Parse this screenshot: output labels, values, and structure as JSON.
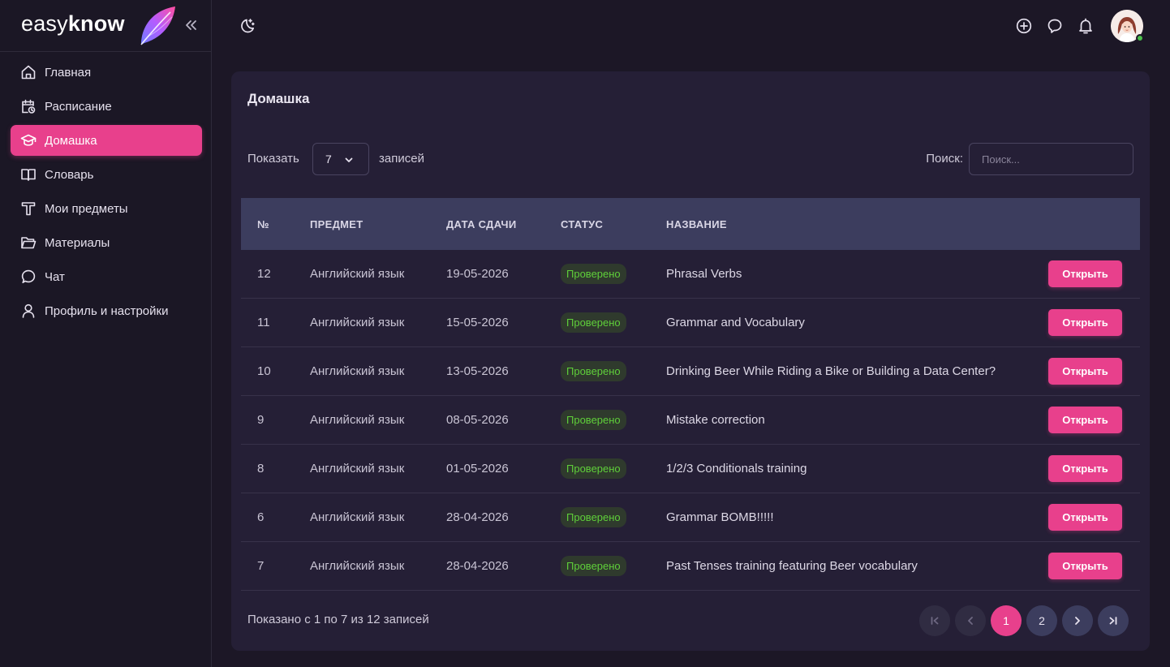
{
  "brand": {
    "name_light": "easy",
    "name_bold": "know"
  },
  "sidebar": {
    "items": [
      {
        "label": "Главная",
        "icon": "home-icon"
      },
      {
        "label": "Расписание",
        "icon": "calendar-clock-icon"
      },
      {
        "label": "Домашка",
        "icon": "graduation-cap-icon",
        "active": true
      },
      {
        "label": "Словарь",
        "icon": "book-icon"
      },
      {
        "label": "Мои предметы",
        "icon": "text-t-icon"
      },
      {
        "label": "Материалы",
        "icon": "folder-icon"
      },
      {
        "label": "Чат",
        "icon": "chat-icon"
      },
      {
        "label": "Профиль и настройки",
        "icon": "user-icon"
      }
    ]
  },
  "page": {
    "title": "Домашка",
    "show_label": "Показать",
    "page_size": "7",
    "records_label": "записей",
    "search_label": "Поиск:",
    "search_placeholder": "Поиск..."
  },
  "table": {
    "headers": [
      "№",
      "ПРЕДМЕТ",
      "ДАТА СДАЧИ",
      "СТАТУС",
      "НАЗВАНИЕ"
    ],
    "open_label": "Открыть",
    "rows": [
      {
        "num": "12",
        "subject": "Английский язык",
        "date": "19-05-2026",
        "status": "Проверено",
        "name": "Phrasal Verbs"
      },
      {
        "num": "11",
        "subject": "Английский язык",
        "date": "15-05-2026",
        "status": "Проверено",
        "name": "Grammar and Vocabulary"
      },
      {
        "num": "10",
        "subject": "Английский язык",
        "date": "13-05-2026",
        "status": "Проверено",
        "name": "Drinking Beer While Riding a Bike or Building a Data Center?"
      },
      {
        "num": "9",
        "subject": "Английский язык",
        "date": "08-05-2026",
        "status": "Проверено",
        "name": "Mistake correction"
      },
      {
        "num": "8",
        "subject": "Английский язык",
        "date": "01-05-2026",
        "status": "Проверено",
        "name": "1/2/3 Conditionals training"
      },
      {
        "num": "6",
        "subject": "Английский язык",
        "date": "28-04-2026",
        "status": "Проверено",
        "name": "Grammar BOMB!!!!!"
      },
      {
        "num": "7",
        "subject": "Английский язык",
        "date": "28-04-2026",
        "status": "Проверено",
        "name": "Past Tenses training featuring Beer vocabulary"
      }
    ]
  },
  "footer": {
    "info": "Показано с 1 по 7 из 12 записей",
    "pages": [
      "1",
      "2"
    ],
    "current_page": "1"
  },
  "colors": {
    "accent": "#e8408c",
    "status_green": "#5fcf3a",
    "header_bg": "#3c3d5e"
  }
}
